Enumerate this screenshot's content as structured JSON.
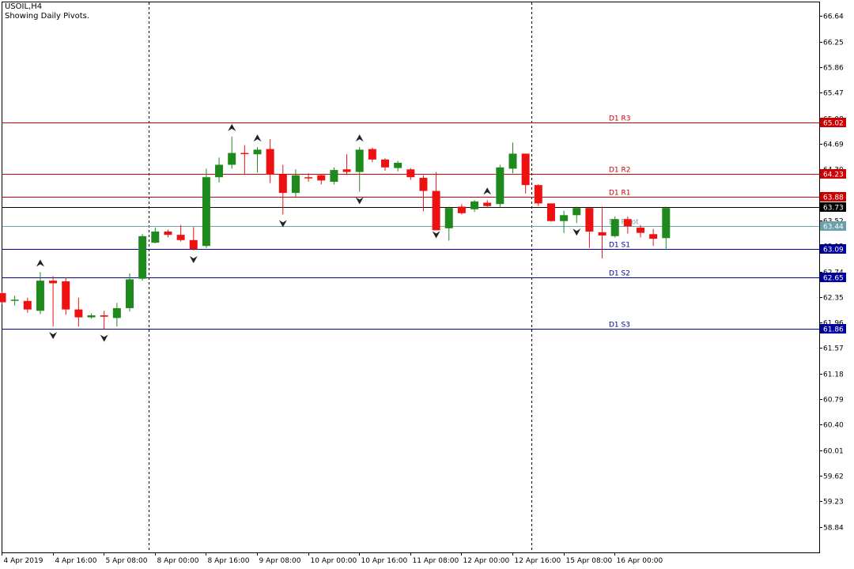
{
  "header": {
    "symbol_line": "USOIL,H4",
    "subtitle": "Showing Daily Pivots."
  },
  "colors": {
    "bull": "#1e8a1e",
    "bear": "#ee1111",
    "resistance": "#cc0000",
    "support": "#00009c",
    "pivot": "#6aa0aa",
    "current": "#000000"
  },
  "chart_data": {
    "type": "candlestick",
    "ylim": [
      58.45,
      66.85
    ],
    "y_ticks": [
      "66.64",
      "66.25",
      "65.86",
      "65.47",
      "65.08",
      "64.69",
      "64.30",
      "63.91",
      "63.52",
      "63.13",
      "62.74",
      "62.35",
      "61.96",
      "61.57",
      "61.18",
      "60.79",
      "60.40",
      "60.01",
      "59.62",
      "59.23",
      "58.84"
    ],
    "x_ticks": [
      {
        "label": "4 Apr 2019",
        "i": 0
      },
      {
        "label": "4 Apr 16:00",
        "i": 4
      },
      {
        "label": "5 Apr 08:00",
        "i": 8
      },
      {
        "label": "8 Apr 00:00",
        "i": 12
      },
      {
        "label": "8 Apr 16:00",
        "i": 16
      },
      {
        "label": "9 Apr 08:00",
        "i": 20
      },
      {
        "label": "10 Apr 00:00",
        "i": 24
      },
      {
        "label": "10 Apr 16:00",
        "i": 28
      },
      {
        "label": "11 Apr 08:00",
        "i": 32
      },
      {
        "label": "12 Apr 00:00",
        "i": 36
      },
      {
        "label": "12 Apr 16:00",
        "i": 40
      },
      {
        "label": "15 Apr 08:00",
        "i": 44
      },
      {
        "label": "16 Apr 00:00",
        "i": 48
      }
    ],
    "day_separators": [
      11.5,
      41.5
    ],
    "candles": [
      {
        "o": 62.41,
        "h": 62.44,
        "l": 62.24,
        "c": 62.27
      },
      {
        "o": 62.31,
        "h": 62.37,
        "l": 62.22,
        "c": 62.31
      },
      {
        "o": 62.29,
        "h": 62.34,
        "l": 62.11,
        "c": 62.16
      },
      {
        "o": 62.14,
        "h": 62.73,
        "l": 62.09,
        "c": 62.6
      },
      {
        "o": 62.6,
        "h": 62.67,
        "l": 61.9,
        "c": 62.56
      },
      {
        "o": 62.59,
        "h": 62.65,
        "l": 62.08,
        "c": 62.16
      },
      {
        "o": 62.16,
        "h": 62.34,
        "l": 61.9,
        "c": 62.04
      },
      {
        "o": 62.04,
        "h": 62.1,
        "l": 62.02,
        "c": 62.07
      },
      {
        "o": 62.07,
        "h": 62.14,
        "l": 61.86,
        "c": 62.05
      },
      {
        "o": 62.03,
        "h": 62.26,
        "l": 61.9,
        "c": 62.18
      },
      {
        "o": 62.18,
        "h": 62.71,
        "l": 62.13,
        "c": 62.62
      },
      {
        "o": 62.63,
        "h": 63.31,
        "l": 62.6,
        "c": 63.28
      },
      {
        "o": 63.18,
        "h": 63.41,
        "l": 63.17,
        "c": 63.35
      },
      {
        "o": 63.35,
        "h": 63.38,
        "l": 63.26,
        "c": 63.3
      },
      {
        "o": 63.3,
        "h": 63.45,
        "l": 63.2,
        "c": 63.22
      },
      {
        "o": 63.22,
        "h": 63.42,
        "l": 63.06,
        "c": 63.08
      },
      {
        "o": 63.13,
        "h": 64.31,
        "l": 63.1,
        "c": 64.18
      },
      {
        "o": 64.18,
        "h": 64.48,
        "l": 64.1,
        "c": 64.37
      },
      {
        "o": 64.37,
        "h": 64.8,
        "l": 64.31,
        "c": 64.55
      },
      {
        "o": 64.55,
        "h": 64.67,
        "l": 64.22,
        "c": 64.54
      },
      {
        "o": 64.53,
        "h": 64.64,
        "l": 64.25,
        "c": 64.6
      },
      {
        "o": 64.61,
        "h": 64.76,
        "l": 64.09,
        "c": 64.22
      },
      {
        "o": 64.22,
        "h": 64.37,
        "l": 63.61,
        "c": 63.94
      },
      {
        "o": 63.94,
        "h": 64.3,
        "l": 63.88,
        "c": 64.21
      },
      {
        "o": 64.18,
        "h": 64.24,
        "l": 64.11,
        "c": 64.17
      },
      {
        "o": 64.21,
        "h": 64.23,
        "l": 64.07,
        "c": 64.13
      },
      {
        "o": 64.11,
        "h": 64.33,
        "l": 64.07,
        "c": 64.29
      },
      {
        "o": 64.3,
        "h": 64.53,
        "l": 64.23,
        "c": 64.26
      },
      {
        "o": 64.26,
        "h": 64.64,
        "l": 63.96,
        "c": 64.6
      },
      {
        "o": 64.61,
        "h": 64.63,
        "l": 64.41,
        "c": 64.45
      },
      {
        "o": 64.45,
        "h": 64.47,
        "l": 64.28,
        "c": 64.33
      },
      {
        "o": 64.32,
        "h": 64.43,
        "l": 64.27,
        "c": 64.4
      },
      {
        "o": 64.3,
        "h": 64.32,
        "l": 64.14,
        "c": 64.18
      },
      {
        "o": 64.17,
        "h": 64.21,
        "l": 63.66,
        "c": 63.97
      },
      {
        "o": 63.97,
        "h": 64.26,
        "l": 63.44,
        "c": 63.37
      },
      {
        "o": 63.4,
        "h": 63.73,
        "l": 63.21,
        "c": 63.71
      },
      {
        "o": 63.73,
        "h": 63.77,
        "l": 63.61,
        "c": 63.63
      },
      {
        "o": 63.69,
        "h": 63.83,
        "l": 63.65,
        "c": 63.81
      },
      {
        "o": 63.79,
        "h": 63.83,
        "l": 63.71,
        "c": 63.74
      },
      {
        "o": 63.77,
        "h": 64.37,
        "l": 63.72,
        "c": 64.33
      },
      {
        "o": 64.31,
        "h": 64.71,
        "l": 64.24,
        "c": 64.54
      },
      {
        "o": 64.54,
        "h": 64.51,
        "l": 63.93,
        "c": 64.06
      },
      {
        "o": 64.06,
        "h": 64.07,
        "l": 63.74,
        "c": 63.78
      },
      {
        "o": 63.78,
        "h": 63.78,
        "l": 63.5,
        "c": 63.51
      },
      {
        "o": 63.51,
        "h": 63.67,
        "l": 63.33,
        "c": 63.6
      },
      {
        "o": 63.6,
        "h": 63.73,
        "l": 63.48,
        "c": 63.71
      },
      {
        "o": 63.71,
        "h": 63.71,
        "l": 63.1,
        "c": 63.35
      },
      {
        "o": 63.34,
        "h": 63.73,
        "l": 62.94,
        "c": 63.29
      },
      {
        "o": 63.28,
        "h": 63.58,
        "l": 63.26,
        "c": 63.54
      },
      {
        "o": 63.54,
        "h": 63.58,
        "l": 63.32,
        "c": 63.43
      },
      {
        "o": 63.41,
        "h": 63.45,
        "l": 63.26,
        "c": 63.33
      },
      {
        "o": 63.31,
        "h": 63.39,
        "l": 63.13,
        "c": 63.24
      },
      {
        "o": 63.25,
        "h": 63.73,
        "l": 63.07,
        "c": 63.71
      }
    ],
    "fractals_up": [
      3,
      18,
      20,
      28,
      38
    ],
    "fractals_down": [
      4,
      8,
      15,
      22,
      28,
      34,
      45
    ],
    "pivots": [
      {
        "name": "D1 R3",
        "value": 65.02,
        "level": "R3",
        "label": "65.02"
      },
      {
        "name": "D1 R2",
        "value": 64.23,
        "level": "R2",
        "label": "64.23"
      },
      {
        "name": "D1 R1",
        "value": 63.88,
        "level": "R1",
        "label": "63.88"
      },
      {
        "name": "D1 Pivot",
        "value": 63.44,
        "level": "P",
        "label": "63.44"
      },
      {
        "name": "D1 S1",
        "value": 63.09,
        "level": "S1",
        "label": "63.09"
      },
      {
        "name": "D1 S2",
        "value": 62.65,
        "level": "S2",
        "label": "62.65"
      },
      {
        "name": "D1 S3",
        "value": 61.86,
        "level": "S3",
        "label": "61.86"
      }
    ],
    "current_price": {
      "value": 63.73,
      "label": "63.73"
    }
  }
}
